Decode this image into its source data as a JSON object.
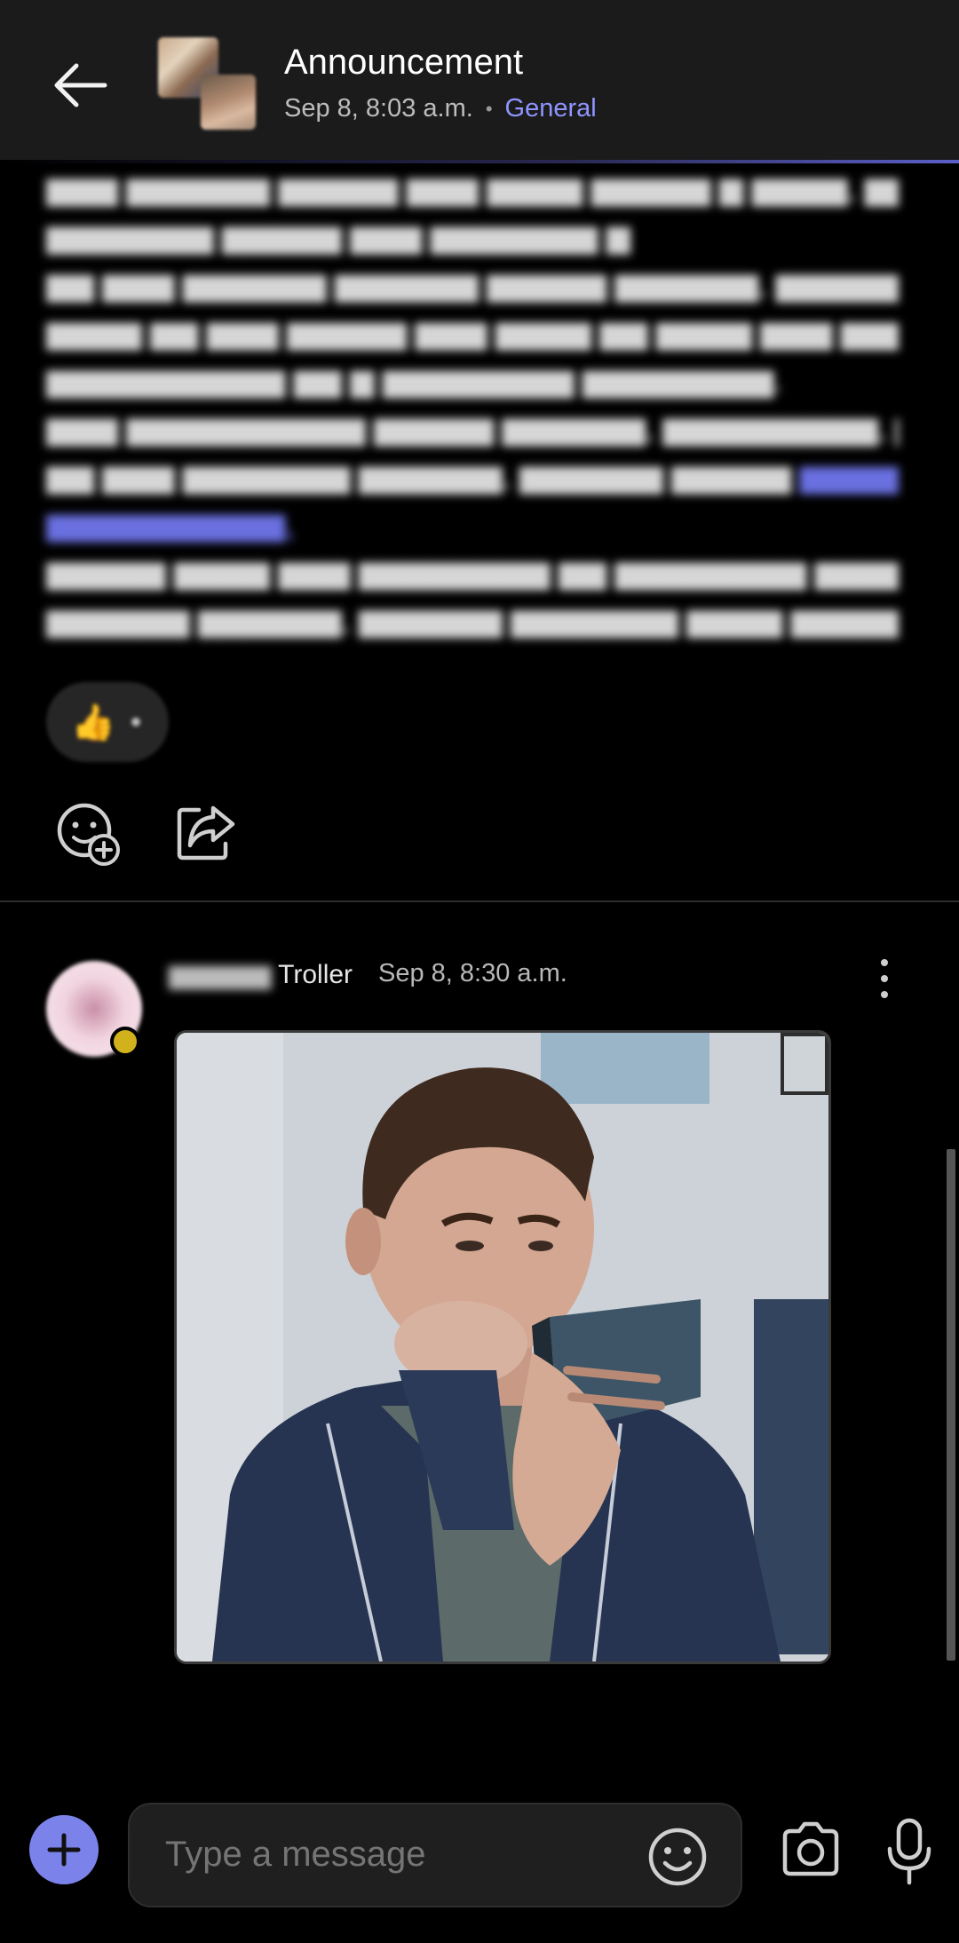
{
  "header": {
    "title": "Announcement",
    "timestamp": "Sep 8, 8:03 a.m.",
    "separator": "•",
    "channel": "General",
    "channel_color": "#8f95ff"
  },
  "message1": {
    "reaction_icon": "thumbs-up-emoji",
    "actions": [
      "add-reaction-icon",
      "share-icon"
    ]
  },
  "message2": {
    "author_visible_part": "Troller",
    "timestamp": "Sep 8, 8:30 a.m.",
    "attachment": "gif-image"
  },
  "composer": {
    "placeholder": "Type a message",
    "accent_color": "#7b83eb"
  }
}
